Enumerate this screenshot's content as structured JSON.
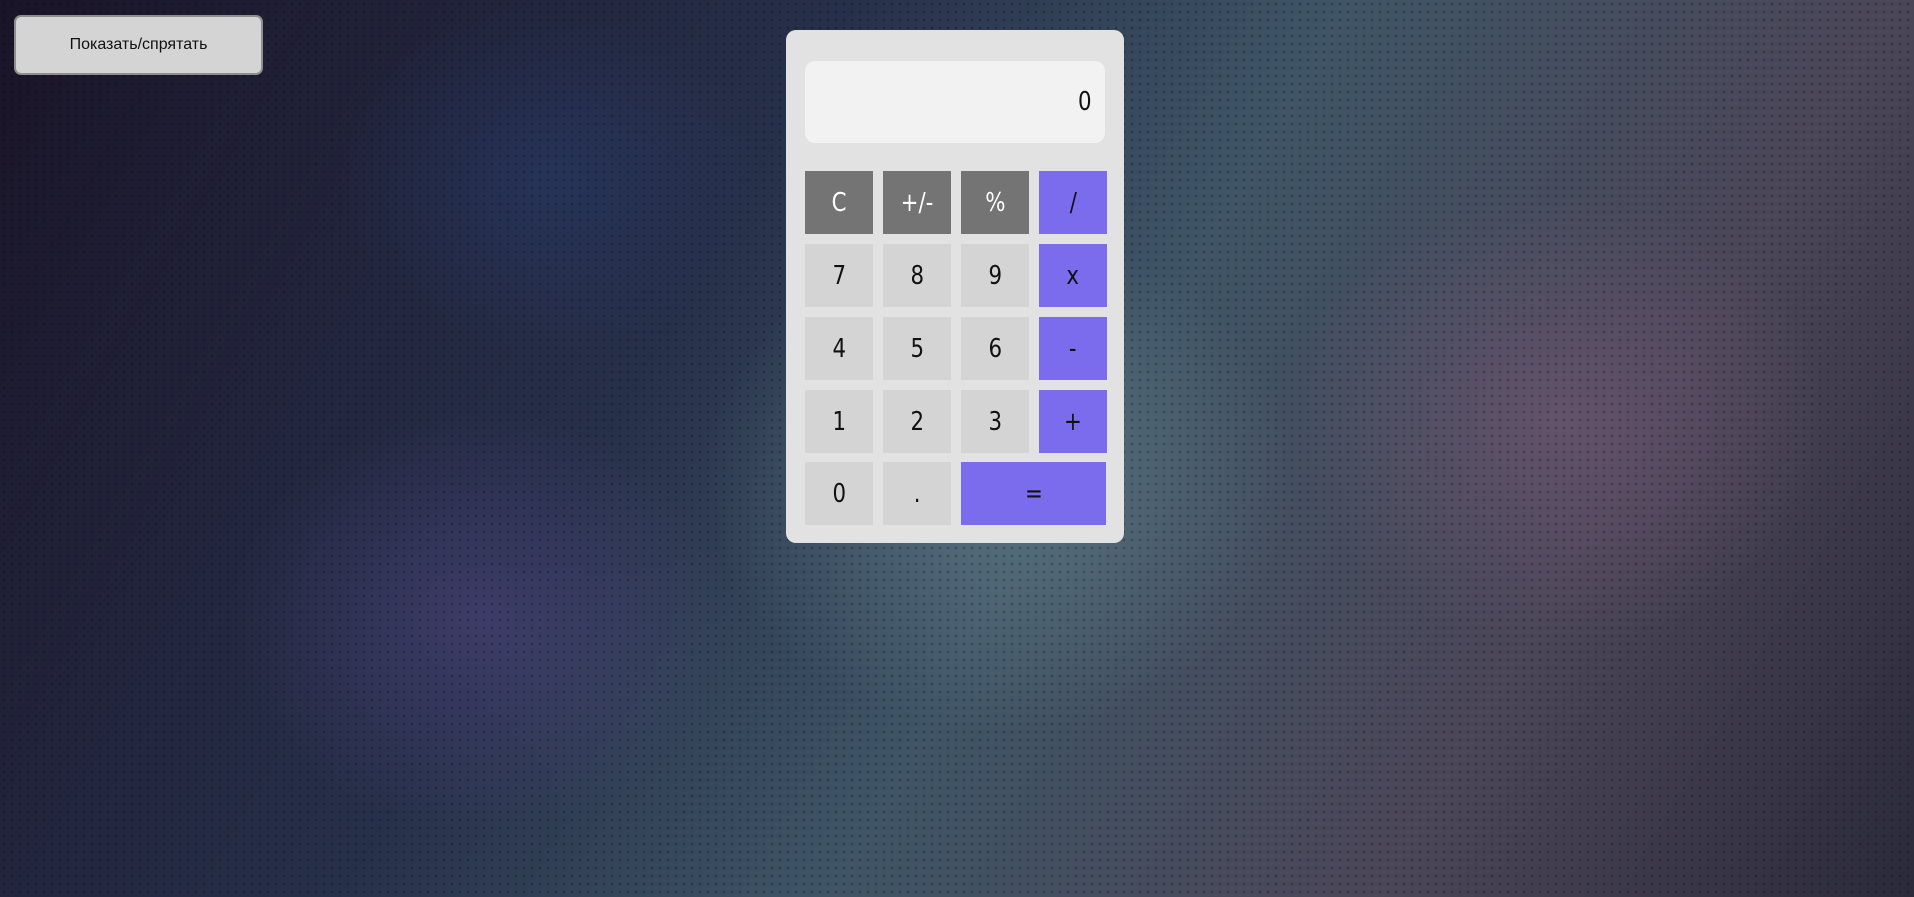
{
  "toggle_button": {
    "label": "Показать/спрятать"
  },
  "display": {
    "value": "0"
  },
  "keys": {
    "clear": "C",
    "sign": "+/-",
    "percent": "%",
    "divide": "/",
    "seven": "7",
    "eight": "8",
    "nine": "9",
    "multiply": "x",
    "four": "4",
    "five": "5",
    "six": "6",
    "minus": "-",
    "one": "1",
    "two": "2",
    "three": "3",
    "plus": "+",
    "zero": "0",
    "dot": ".",
    "equals": "="
  },
  "colors": {
    "function_key": "#747474",
    "number_key": "#d4d4d4",
    "operator_key": "#7b6bed",
    "calculator_body": "#e2e2e2",
    "display_bg": "#f2f2f2"
  }
}
